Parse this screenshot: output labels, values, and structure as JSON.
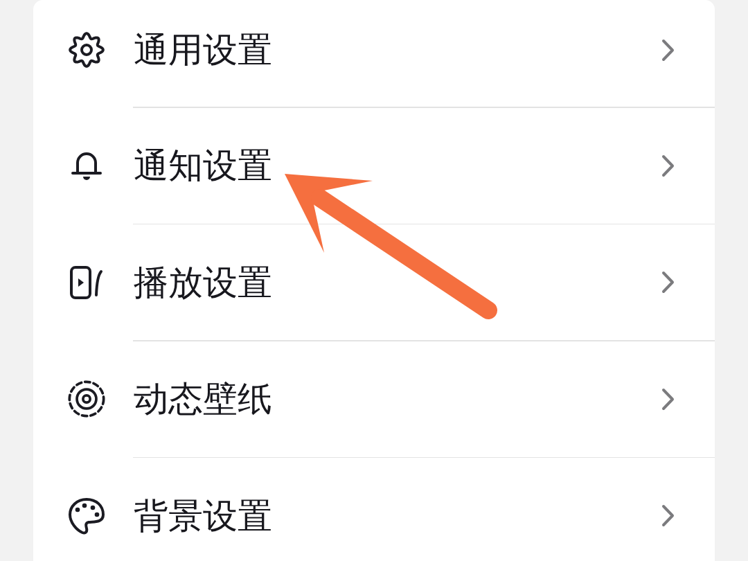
{
  "settings": {
    "items": [
      {
        "label": "通用设置"
      },
      {
        "label": "通知设置"
      },
      {
        "label": "播放设置"
      },
      {
        "label": "动态壁纸"
      },
      {
        "label": "背景设置"
      }
    ]
  }
}
